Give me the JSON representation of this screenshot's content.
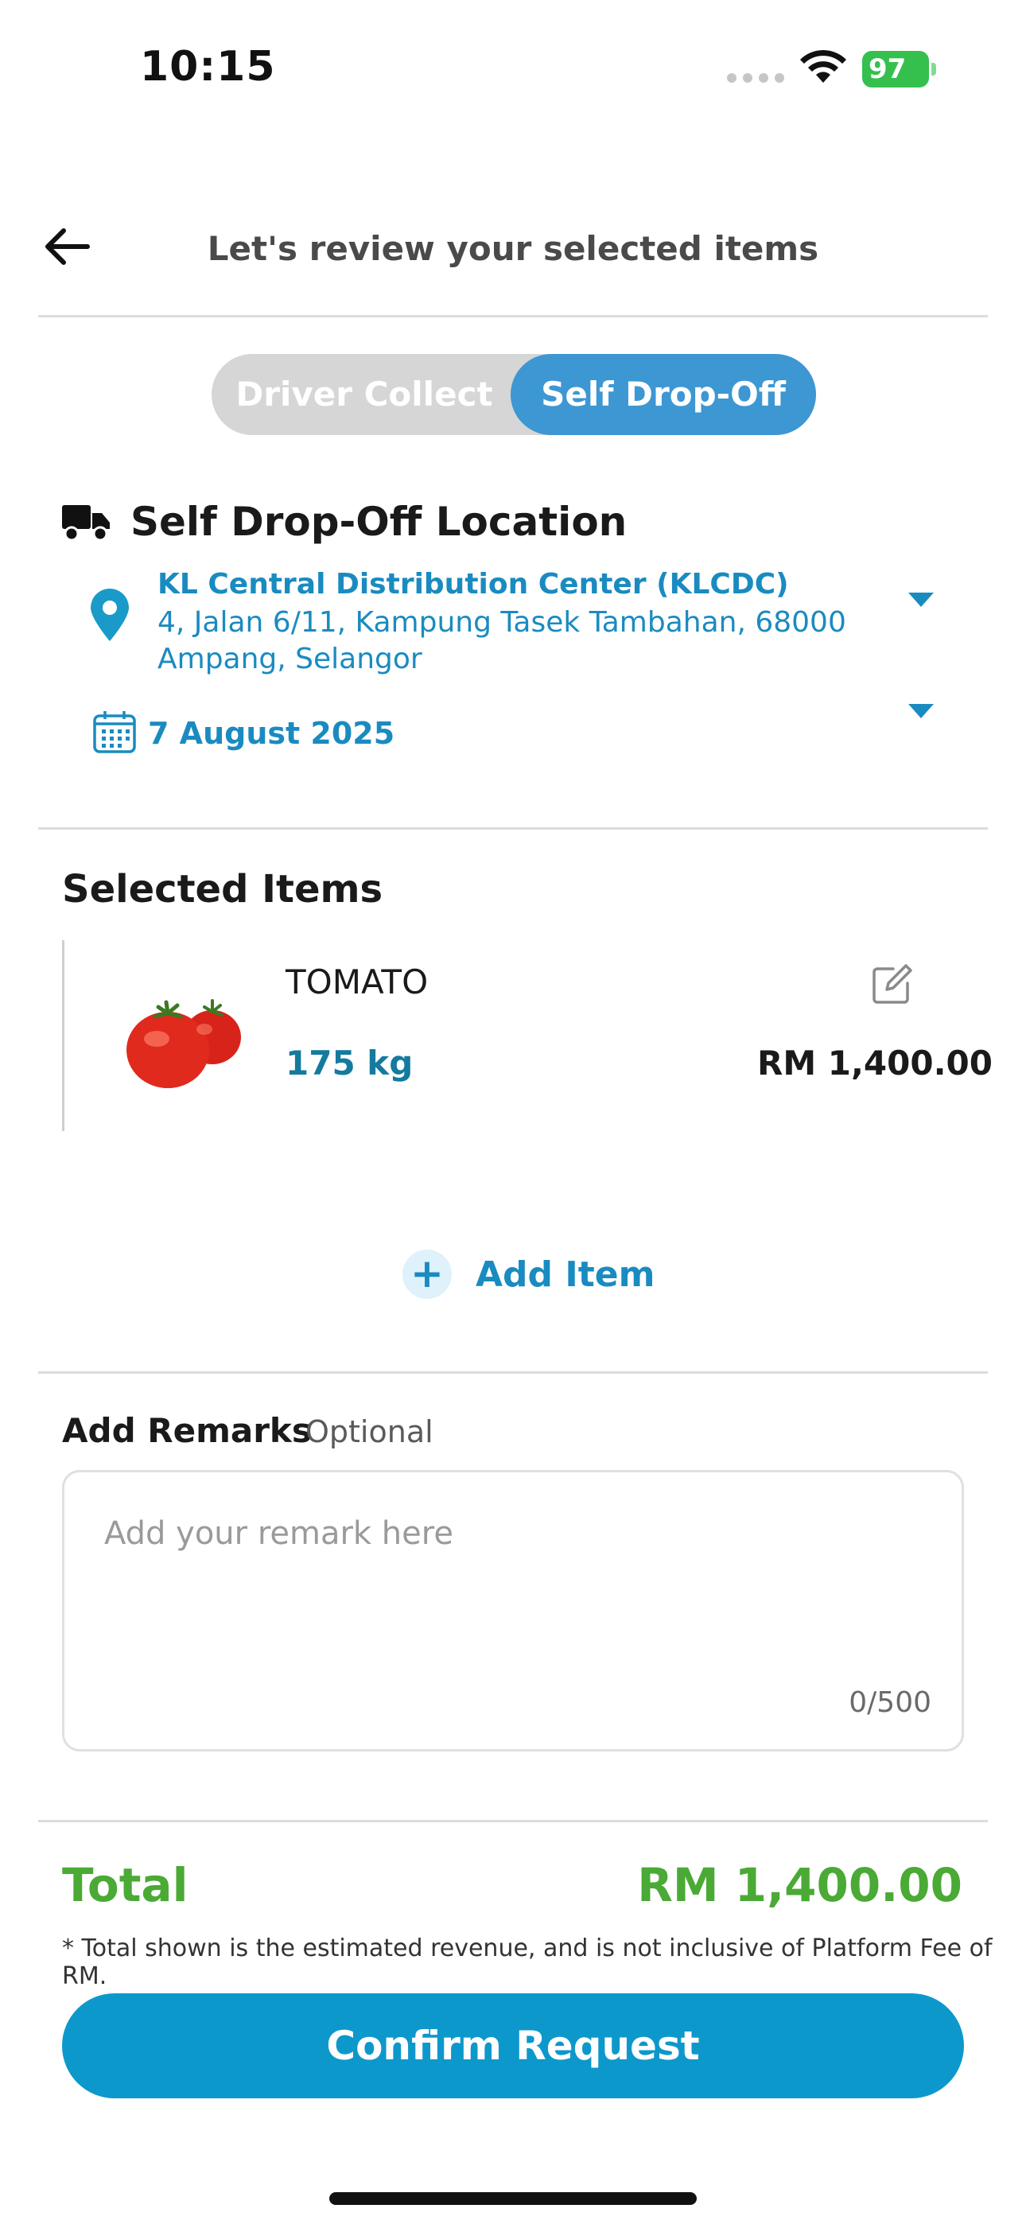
{
  "status_bar": {
    "time": "10:15",
    "battery": "97"
  },
  "header": {
    "title": "Let's review your selected items"
  },
  "mode_toggle": {
    "options": [
      "Driver Collect",
      "Self Drop-Off"
    ],
    "selected": "Self Drop-Off"
  },
  "location": {
    "heading": "Self Drop-Off Location",
    "name": "KL Central Distribution Center (KLCDC)",
    "address": "4, Jalan 6/11, Kampung Tasek Tambahan, 68000 Ampang, Selangor",
    "date": "7 August 2025"
  },
  "selected_items": {
    "title": "Selected Items",
    "items": [
      {
        "name": "TOMATO",
        "quantity": "175 kg",
        "price": "RM 1,400.00"
      }
    ],
    "add_item_label": "Add Item"
  },
  "remarks": {
    "title": "Add Remarks",
    "optional_label": "Optional",
    "placeholder": "Add your remark here",
    "counter": "0/500"
  },
  "total": {
    "label": "Total",
    "value": "RM 1,400.00",
    "note": "* Total shown is the estimated revenue, and is not inclusive of Platform Fee of RM."
  },
  "confirm_button": {
    "label": "Confirm Request"
  },
  "colors": {
    "accent": "#1a8bc0",
    "toggle_active": "#3d97d3",
    "total_green": "#4aaa35",
    "button": "#0d98cc"
  }
}
